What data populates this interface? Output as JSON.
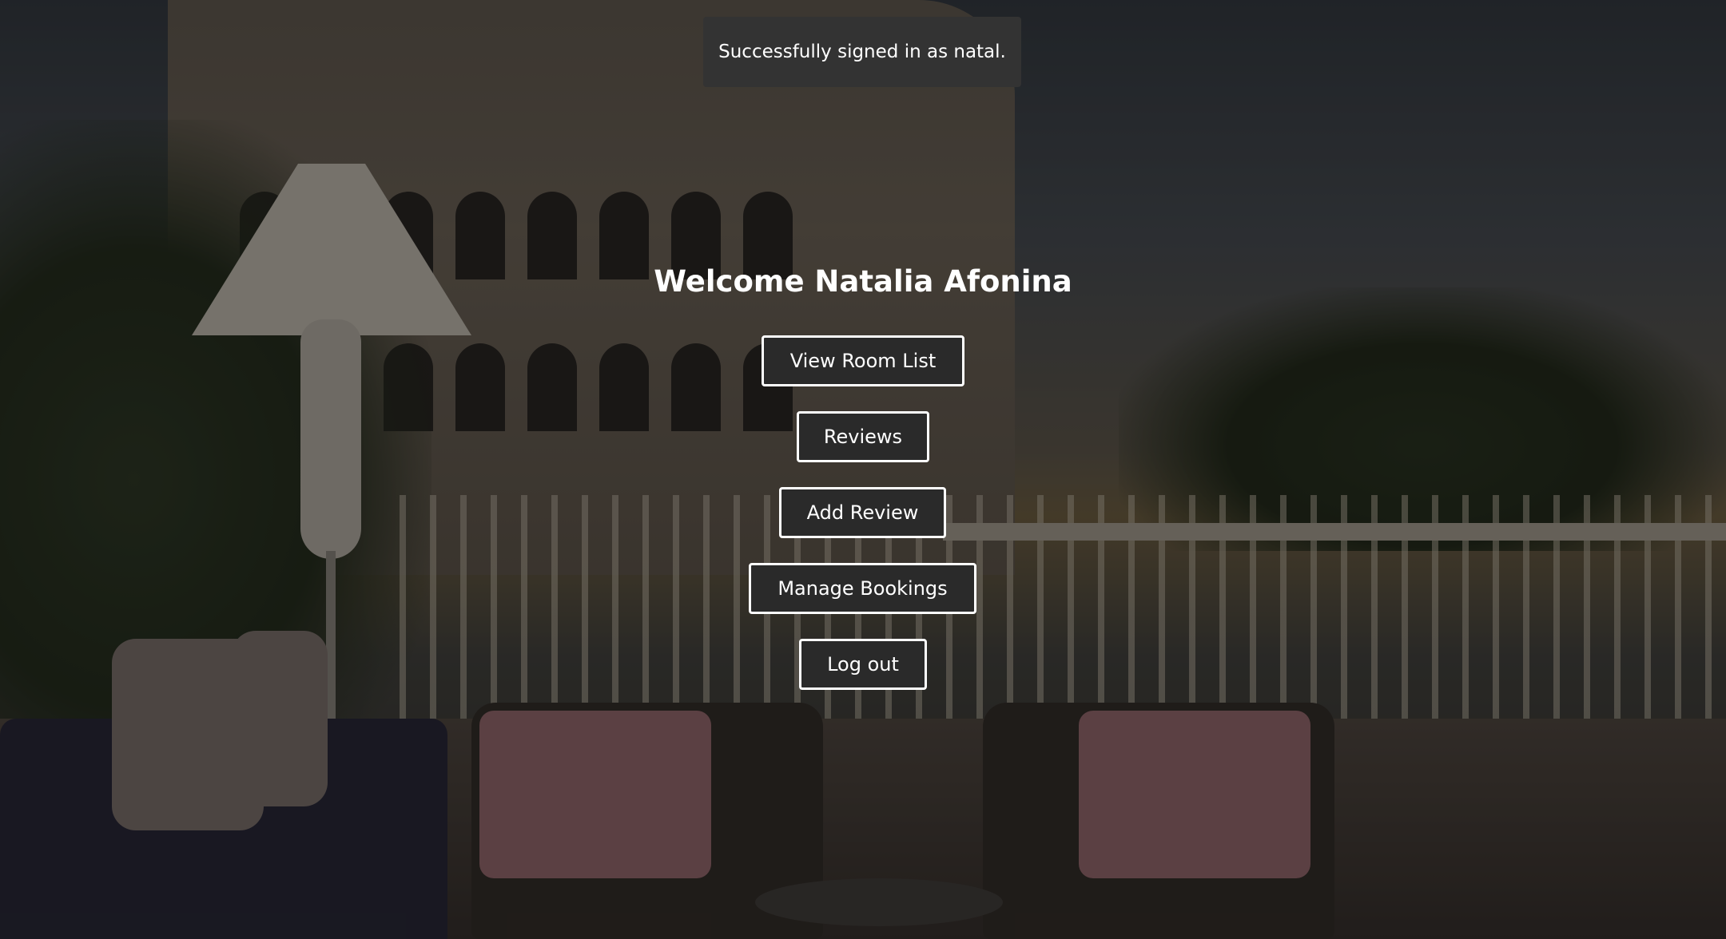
{
  "toast": {
    "message": "Successfully signed in as natal."
  },
  "header": {
    "welcome": "Welcome Natalia Afonina"
  },
  "menu": {
    "view_room_list": "View Room List",
    "reviews": "Reviews",
    "add_review": "Add Review",
    "manage_bookings": "Manage Bookings",
    "log_out": "Log out"
  },
  "colors": {
    "button_bg": "#2a2a2a",
    "button_border": "#ffffff",
    "text": "#ffffff",
    "toast_bg": "#333333"
  }
}
